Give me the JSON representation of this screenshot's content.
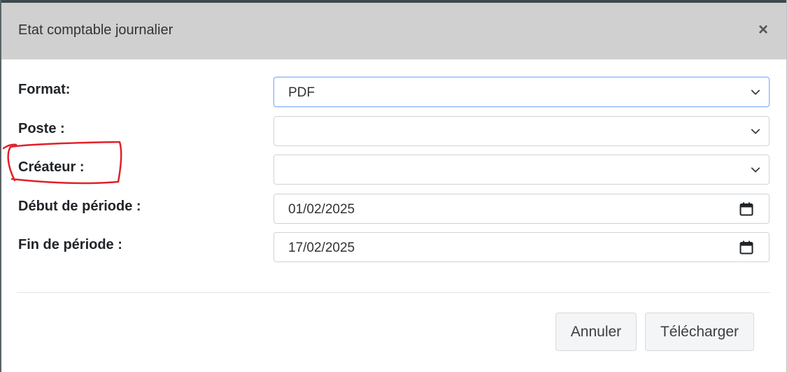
{
  "modal": {
    "title": "Etat comptable journalier",
    "close_icon": "close-icon",
    "close_glyph": "×"
  },
  "form": {
    "format": {
      "label": "Format:",
      "value": "PDF",
      "icon": "chevron-down-icon"
    },
    "poste": {
      "label": "Poste :",
      "value": "",
      "icon": "chevron-down-icon"
    },
    "createur": {
      "label": "Créateur :",
      "value": "",
      "icon": "chevron-down-icon"
    },
    "debut": {
      "label": "Début de période :",
      "value": "01/02/2025",
      "icon": "calendar-icon"
    },
    "fin": {
      "label": "Fin de période :",
      "value": "17/02/2025",
      "icon": "calendar-icon"
    }
  },
  "footer": {
    "cancel_label": "Annuler",
    "download_label": "Télécharger"
  },
  "colors": {
    "header_bg": "#d0d0d0",
    "annotation_red": "#e0202a",
    "focus_border": "#86b7fe"
  }
}
